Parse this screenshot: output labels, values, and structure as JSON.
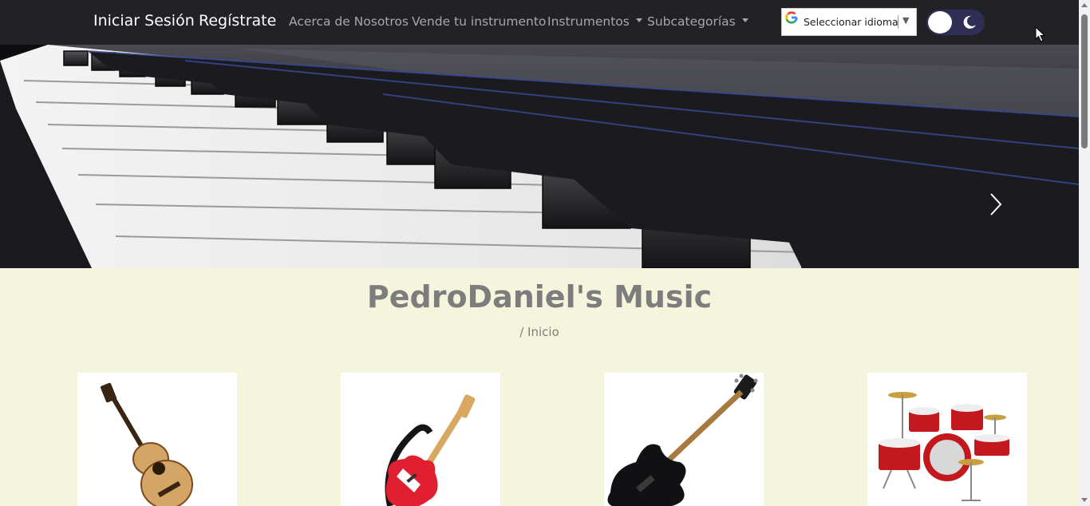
{
  "nav": {
    "login": "Iniciar Sesión",
    "register": "Regístrate",
    "about": "Acerca de Nosotros",
    "sell": "Vende tu instrumento",
    "instruments": "Instrumentos",
    "subcategories": "Subcategorías"
  },
  "translate": {
    "label": "Seleccionar idioma",
    "arrow": "▼",
    "icon": "google-g-icon"
  },
  "theme_toggle": {
    "icon": "moon-icon",
    "state": "light"
  },
  "hero": {
    "image": "piano-keys-photo",
    "next_icon": "chevron-right-icon"
  },
  "page": {
    "title": "PedroDaniel's Music",
    "breadcrumb": "/ Inicio"
  },
  "categories": [
    {
      "image": "acoustic-guitar"
    },
    {
      "image": "electric-guitar"
    },
    {
      "image": "bass-guitar"
    },
    {
      "image": "drum-kit"
    }
  ],
  "colors": {
    "navbar": "#212126",
    "page_background": "#f5f4dc",
    "title": "#7d7d7d",
    "toggle": "#2f2f55"
  }
}
